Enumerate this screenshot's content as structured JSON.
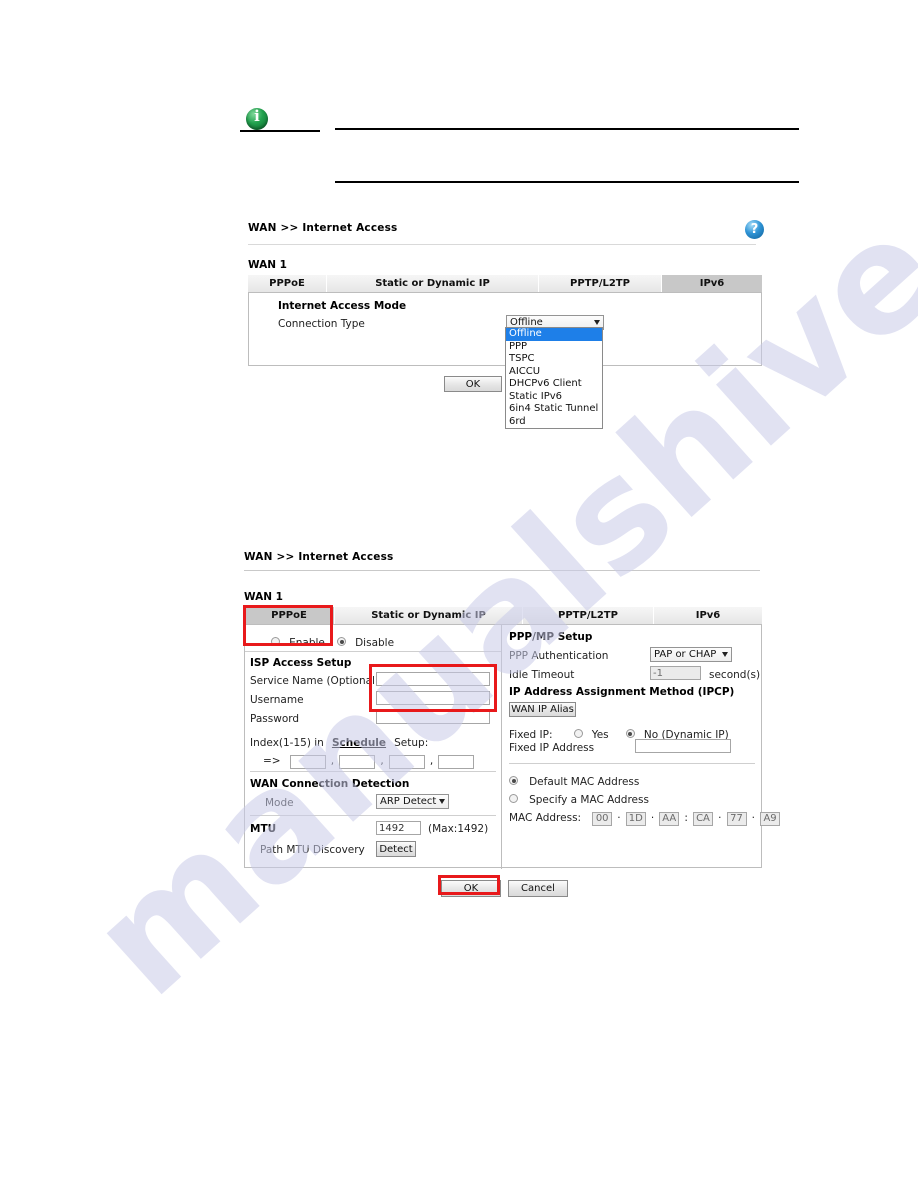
{
  "page": {
    "header_icon": "info-icon"
  },
  "section1": {
    "breadcrumb": "WAN >> Internet Access",
    "help_icon": "help-icon",
    "wan_label": "WAN 1",
    "tabs": [
      {
        "label": "PPPoE",
        "selected": false
      },
      {
        "label": "Static or Dynamic IP",
        "selected": false
      },
      {
        "label": "PPTP/L2TP",
        "selected": false
      },
      {
        "label": "IPv6",
        "selected": true
      }
    ],
    "group_title": "Internet Access Mode",
    "connection_type_label": "Connection Type",
    "connection_type_value": "Offline",
    "connection_type_options": [
      "Offline",
      "PPP",
      "TSPC",
      "AICCU",
      "DHCPv6 Client",
      "Static IPv6",
      "6in4 Static Tunnel",
      "6rd"
    ],
    "ok_label": "OK"
  },
  "section2": {
    "breadcrumb": "WAN >> Internet Access",
    "wan_label": "WAN 1",
    "tabs": [
      {
        "label": "PPPoE",
        "selected": true
      },
      {
        "label": "Static or Dynamic IP",
        "selected": false
      },
      {
        "label": "PPTP/L2TP",
        "selected": false
      },
      {
        "label": "IPv6",
        "selected": false
      }
    ],
    "enable_label": "Enable",
    "disable_label": "Disable",
    "enable_selected": false,
    "disable_selected": true,
    "isp": {
      "title": "ISP Access Setup",
      "service_name_label": "Service Name (Optional)",
      "service_name_value": "",
      "username_label": "Username",
      "username_value": "",
      "password_label": "Password",
      "password_value": "",
      "schedule_prefix": "Index(1-15) in",
      "schedule_link": "Schedule",
      "schedule_suffix": "Setup:",
      "schedule_arrow": "=>",
      "schedule_values": [
        "",
        "",
        "",
        ""
      ],
      "comma": ","
    },
    "wan_detect": {
      "title": "WAN Connection Detection",
      "mode_label": "Mode",
      "mode_value": "ARP Detect"
    },
    "mtu": {
      "title": "MTU",
      "value": "1492",
      "max_note": "(Max:1492)",
      "path_discovery_label": "Path MTU Discovery",
      "detect_button": "Detect"
    },
    "pppmp": {
      "title": "PPP/MP Setup",
      "auth_label": "PPP Authentication",
      "auth_value": "PAP or CHAP",
      "idle_label": "Idle Timeout",
      "idle_value": "-1",
      "idle_unit": "second(s)"
    },
    "ipcp": {
      "title": "IP Address Assignment Method (IPCP)",
      "wan_ip_alias_button": "WAN IP Alias",
      "fixed_ip_label": "Fixed IP:",
      "yes_label": "Yes",
      "no_label": "No (Dynamic IP)",
      "yes_selected": false,
      "no_selected": true,
      "fixed_ip_address_label": "Fixed IP Address",
      "fixed_ip_address_value": ""
    },
    "mac": {
      "default_label": "Default MAC Address",
      "specify_label": "Specify a MAC Address",
      "default_selected": true,
      "specify_selected": false,
      "address_label": "MAC Address:",
      "octets": [
        "00",
        "1D",
        "AA",
        "CA",
        "77",
        "A9"
      ],
      "sep_dot": "·",
      "sep_colon": ":"
    },
    "ok_label": "OK",
    "cancel_label": "Cancel"
  },
  "watermark": {
    "text": "manualshive.com"
  },
  "colors": {
    "accent_red": "#e8191b",
    "select_blue": "#1e7fe8",
    "tab_selected": "#c8c8c8"
  }
}
